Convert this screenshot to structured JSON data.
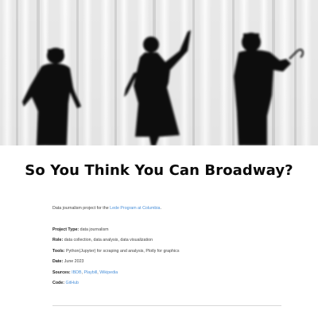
{
  "hero": {
    "alt_icon": "photo-silhouettes-curtain"
  },
  "title": "So You Think You Can Broadway?",
  "intro": {
    "prefix": "Data journalism project for the ",
    "link": "Lede Program at Columbia",
    "suffix": "."
  },
  "meta": {
    "project_type": {
      "label": "Project Type:",
      "value": " data journalism"
    },
    "role": {
      "label": "Role:",
      "value": " data collection, data analysis, data visualization"
    },
    "tools": {
      "label": "Tools:",
      "value": " Python(Jupyter) for scraping and analysis, Plotly for graphics"
    },
    "date": {
      "label": "Date:",
      "value": " June 2023"
    },
    "sources": {
      "label": "Sources:",
      "link1": "IBDB",
      "sep1": ", ",
      "link2": "Playbill",
      "sep2": ", ",
      "link3": "Wikipedia"
    },
    "code": {
      "label": "Code:",
      "link": "GitHub"
    }
  },
  "colors": {
    "link": "#4a90d9",
    "title": "#0a0a0a",
    "divider": "#d8d8d8"
  }
}
